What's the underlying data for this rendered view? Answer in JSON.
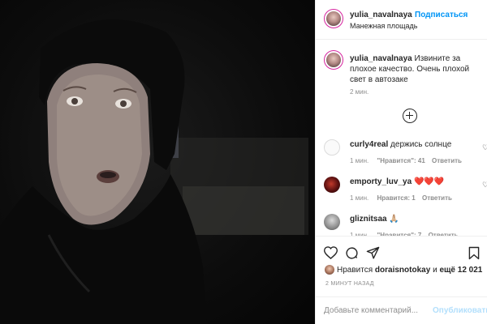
{
  "post": {
    "username": "yulia_navalnaya",
    "separator": "•",
    "follow_label": "Подписаться",
    "location": "Манежная площадь",
    "caption_text": "Извините за плохое качество. Очень плохой свет в автозаке",
    "caption_time": "2 мин."
  },
  "comments": [
    {
      "user": "curly4real",
      "text": "держись солнце",
      "time": "1 мин.",
      "likes": "\"Нравится\": 41",
      "reply": "Ответить"
    },
    {
      "user": "emporty_luv_ya",
      "text": "❤️❤️❤️",
      "time": "1 мин.",
      "likes": "Нравится: 1",
      "reply": "Ответить"
    },
    {
      "user": "gliznitsaa",
      "text": "🙏🏼",
      "time": "1 мин.",
      "likes": "\"Нравится\": 7",
      "reply": "Ответить"
    }
  ],
  "likes": {
    "prefix": "Нравится",
    "user": "doraisnotokay",
    "and": "и",
    "others": "ещё 12 021"
  },
  "post_time": "2 МИНУТ НАЗАД",
  "add_comment": {
    "placeholder": "Добавьте комментарий...",
    "publish_label": "Опубликовать"
  }
}
